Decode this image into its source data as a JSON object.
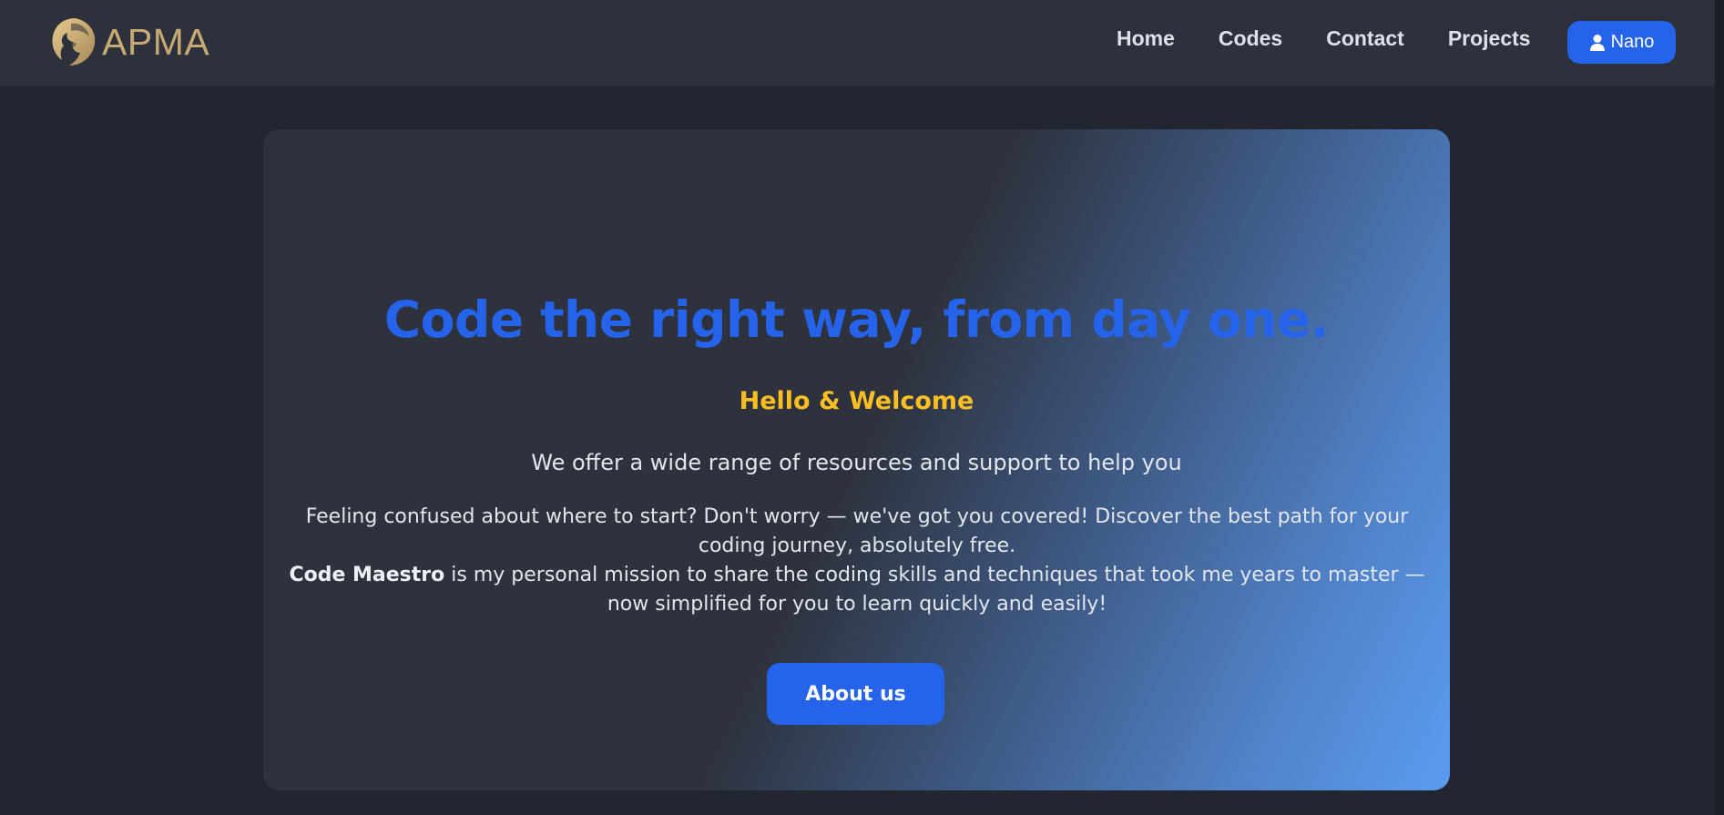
{
  "brand": {
    "name": "APMA",
    "logo_icon": "lion-head-icon"
  },
  "nav": {
    "links": [
      "Home",
      "Codes",
      "Contact",
      "Projects"
    ],
    "user_label": "Nano",
    "user_icon": "user-icon"
  },
  "hero": {
    "title": "Code the right way, from day one.",
    "subtitle": "Hello & Welcome",
    "lead": "We offer a wide range of resources and support to help you",
    "body_line1": "Feeling confused about where to start? Don't worry — we've got you covered! Discover the best path for your coding journey, absolutely free.",
    "body_strong": "Code Maestro",
    "body_line2": " is my personal mission to share the coding skills and techniques that took me years to master — now simplified for you to learn quickly and easily!",
    "button_label": "About us"
  },
  "colors": {
    "accent": "#2563eb",
    "highlight": "#fbbf24",
    "background": "#222630",
    "navbar": "#2d313b",
    "brand_gold": "#c7a973"
  }
}
